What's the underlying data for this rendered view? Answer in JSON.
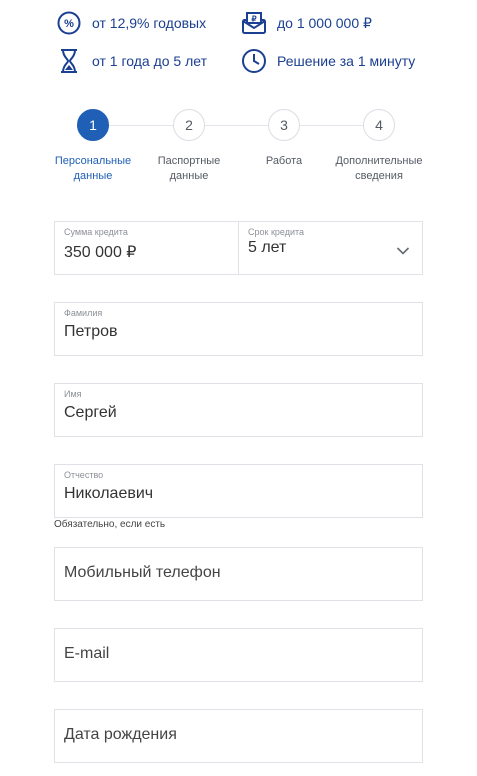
{
  "features": [
    {
      "text": "от 12,9% годовых",
      "icon": "percent-icon"
    },
    {
      "text": "до 1 000 000 ₽",
      "icon": "envelope-money-icon"
    },
    {
      "text": "от 1 года до 5 лет",
      "icon": "hourglass-icon"
    },
    {
      "text": "Решение за 1 минуту",
      "icon": "clock-icon"
    }
  ],
  "steps": [
    {
      "num": "1",
      "label": "Персональные данные",
      "active": true
    },
    {
      "num": "2",
      "label": "Паспортные данные",
      "active": false
    },
    {
      "num": "3",
      "label": "Работа",
      "active": false
    },
    {
      "num": "4",
      "label": "Дополнительные сведения",
      "active": false
    }
  ],
  "form": {
    "amount": {
      "label": "Сумма кредита",
      "value": "350 000 ₽"
    },
    "term": {
      "label": "Срок кредита",
      "value": "5 лет"
    },
    "surname": {
      "label": "Фамилия",
      "value": "Петров"
    },
    "name": {
      "label": "Имя",
      "value": "Сергей"
    },
    "patronymic": {
      "label": "Отчество",
      "value": "Николаевич",
      "hint": "Обязательно, если есть"
    },
    "phone": {
      "placeholder": "Мобильный телефон"
    },
    "email": {
      "placeholder": "E-mail"
    },
    "birthdate": {
      "placeholder": "Дата рождения"
    }
  },
  "colors": {
    "accent": "#1f5fb5",
    "feature_text": "#1b3f91"
  }
}
